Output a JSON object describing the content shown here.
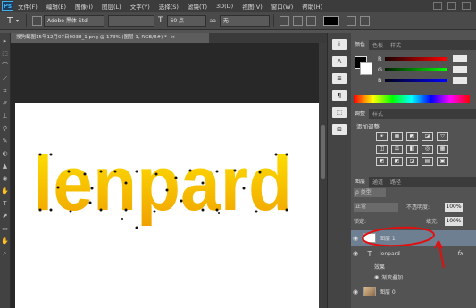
{
  "app": {
    "logo": "Ps"
  },
  "menubar": {
    "items": [
      "文件(F)",
      "编辑(E)",
      "图像(I)",
      "图层(L)",
      "文字(Y)",
      "选择(S)",
      "滤镜(T)",
      "3D(D)",
      "视图(V)",
      "窗口(W)",
      "帮助(H)"
    ]
  },
  "options": {
    "tool_glyph": "T",
    "font_family": "Adobe 黑体 Std",
    "font_style": "-",
    "size_glyph": "T",
    "font_size": "60 点",
    "aa_label": "aa",
    "aa_mode": "无"
  },
  "document": {
    "tab_title": "搜狗截图15年12月07日0038_1.png @ 173% (图层 1, RGB/8#) *",
    "tab_close": "×",
    "canvas_text": "lenpard"
  },
  "tools": [
    "▸",
    "⬚",
    "⌒",
    "⟋",
    "⌗",
    "✐",
    "⊥",
    "⚲",
    "✎",
    "◐",
    "▲",
    "◉",
    "✋",
    "T",
    "⬈",
    "▭",
    "✋",
    "⌕"
  ],
  "midcol": {
    "icons": [
      "i",
      "A",
      "≣",
      "¶",
      "⬚",
      "⊞"
    ]
  },
  "color_panel": {
    "tabs": [
      "颜色",
      "色板",
      "样式"
    ],
    "channels": [
      {
        "label": "R",
        "gradient": [
          "#1a0000",
          "#ff0000"
        ]
      },
      {
        "label": "G",
        "gradient": [
          "#001a00",
          "#00ff00"
        ]
      },
      {
        "label": "B",
        "gradient": [
          "#00001a",
          "#0000ff"
        ]
      }
    ]
  },
  "adjust_panel": {
    "tabs": [
      "调整",
      "样式"
    ],
    "title": "添加调整",
    "row1": [
      "☀",
      "▦",
      "◩",
      "◪",
      "▽"
    ],
    "row2": [
      "◫",
      "⚖",
      "◧",
      "◎",
      "▦"
    ],
    "row3": [
      "◩",
      "◩",
      "◪",
      "▤",
      "▣"
    ]
  },
  "layers_panel": {
    "tabs": [
      "图层",
      "通道",
      "路径"
    ],
    "filter_label": "ρ 类型",
    "blend_mode": "正常",
    "opacity_label": "不透明度:",
    "opacity_value": "100%",
    "lock_label": "锁定:",
    "fill_label": "填充:",
    "fill_value": "100%",
    "layers": [
      {
        "name": "图层 1",
        "selected": true
      },
      {
        "name": "lenpard",
        "type_glyph": "T",
        "fx": "fx"
      },
      {
        "name": "效果"
      },
      {
        "name": "渐变叠加"
      },
      {
        "name": "图层 0"
      }
    ]
  },
  "annotation_color": "#e01010"
}
